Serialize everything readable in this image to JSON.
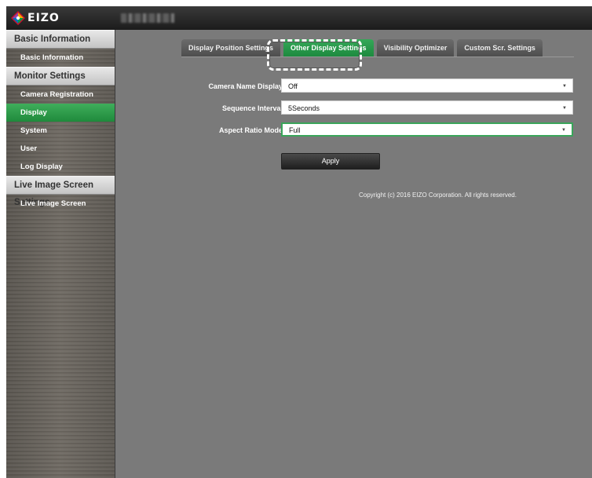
{
  "header": {
    "brand": "EIZO"
  },
  "sidebar": {
    "groups": [
      {
        "title": "Basic Information",
        "items": [
          {
            "label": "Basic Information"
          }
        ]
      },
      {
        "title": "Monitor Settings",
        "items": [
          {
            "label": "Camera Registration"
          },
          {
            "label": "Display"
          },
          {
            "label": "System"
          },
          {
            "label": "User"
          },
          {
            "label": "Log Display"
          }
        ]
      },
      {
        "title": "Live Image Screen Settings",
        "items": [
          {
            "label": "Live Image Screen"
          }
        ]
      }
    ],
    "active_item": "Display"
  },
  "tabs": [
    {
      "label": "Display Position Settings"
    },
    {
      "label": "Other Display Settings"
    },
    {
      "label": "Visibility Optimizer"
    },
    {
      "label": "Custom Scr. Settings"
    }
  ],
  "active_tab": "Other Display Settings",
  "form": {
    "camera_name_display": {
      "label": "Camera Name Display",
      "value": "Off"
    },
    "sequence_interval": {
      "label": "Sequence Interval",
      "value": "5Seconds"
    },
    "aspect_ratio_mode": {
      "label": "Aspect Ratio Mode",
      "value": "Full"
    },
    "apply_label": "Apply"
  },
  "footer": {
    "copyright": "Copyright (c) 2016 EIZO Corporation. All rights reserved."
  },
  "colors": {
    "accent": "#2a9a4a",
    "panel": "#7a7a7a"
  }
}
